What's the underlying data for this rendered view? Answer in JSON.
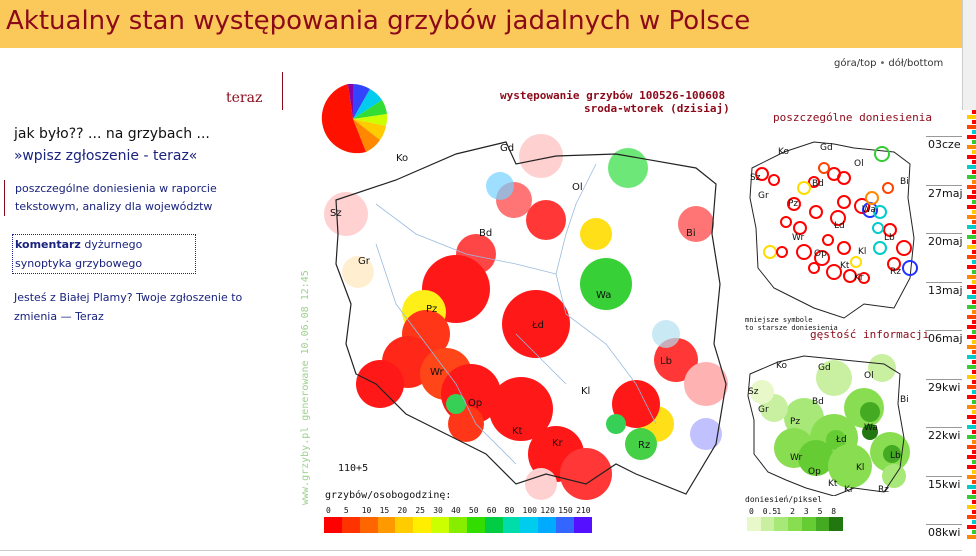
{
  "header": {
    "title": "Aktualny stan występowania grzybów jadalnych w Polsce"
  },
  "top_links": {
    "top": "góra/top",
    "separator": "•",
    "bottom": "dół/bottom"
  },
  "sidebar": {
    "teraz": "teraz",
    "jak": "jak było?? ... na grzybach ...",
    "wpisz": "»wpisz zgłoszenie - teraz«",
    "poszczegolne": "poszczególne doniesienia w raporcie tekstowym, analizy dla województw",
    "komentarz_bold": "komentarz",
    "komentarz_rest": " dyżurnego synoptyka grzybowego",
    "biala": "Jesteś z Białej Plamy? Twoje zgłoszenie to zmienia — Teraz"
  },
  "main_map": {
    "title1": "występowanie grzybów 100526-100608",
    "title2": "sroda-wtorek (dzisiaj)",
    "generated": "www.grzyby.pl generowane 10.06.08 12:45",
    "corner_label": "110+5",
    "cities": [
      "Ko",
      "Gd",
      "Ol",
      "Sz",
      "Bd",
      "Bi",
      "Gr",
      "Pz",
      "Wa",
      "Łd",
      "Lb",
      "Wr",
      "Op",
      "Kl",
      "Kt",
      "Kr",
      "Rz"
    ],
    "legend_title": "grzybów/osobogodzinę:",
    "legend_ticks": [
      "0",
      "5",
      "10",
      "15",
      "20",
      "25",
      "30",
      "40",
      "50",
      "60",
      "80",
      "100",
      "120",
      "150",
      "210"
    ],
    "legend_colors": [
      "#ff0000",
      "#ff3300",
      "#ff6600",
      "#ff9900",
      "#ffcc00",
      "#ffee00",
      "#ccff00",
      "#88ee00",
      "#33dd00",
      "#00cc44",
      "#00ddaa",
      "#00ccee",
      "#00aaff",
      "#3366ff",
      "#5511ff"
    ]
  },
  "right_panel": {
    "title1": "poszczególne doniesienia",
    "title2": "gęstość informacji",
    "note_line1": "mniejsze symbole",
    "note_line2": "to starsze doniesienia",
    "map2_cities": [
      "Ko",
      "Gd",
      "Ol",
      "Sz",
      "Bd",
      "Bi",
      "Gr",
      "Pz",
      "Wa",
      "Łd",
      "Lb",
      "Wr",
      "Op",
      "Kl",
      "Kt",
      "Kr",
      "Rz"
    ],
    "map3_cities": [
      "Ko",
      "Gd",
      "Ol",
      "Sz",
      "Bd",
      "Bi",
      "Gr",
      "Pz",
      "Wa",
      "Łd",
      "Lb",
      "Wr",
      "Op",
      "Kl",
      "Kt",
      "Kr",
      "Rz"
    ],
    "density_title": "doniesień/piksel",
    "density_ticks": [
      "0",
      "0.5",
      "1",
      "2",
      "3",
      "5",
      "8"
    ],
    "density_colors": [
      "#e8f8c8",
      "#c8f0a0",
      "#a8e878",
      "#88dd50",
      "#66cc33",
      "#44aa22",
      "#227711"
    ]
  },
  "timeline": {
    "labels": [
      "03cze",
      "27maj",
      "20maj",
      "13maj",
      "06maj",
      "29kwi",
      "22kwi",
      "15kwi",
      "08kwi"
    ]
  },
  "colors": {
    "header_bg": "#fbc85a",
    "title": "#8b0a1a",
    "link": "#1a237e"
  }
}
